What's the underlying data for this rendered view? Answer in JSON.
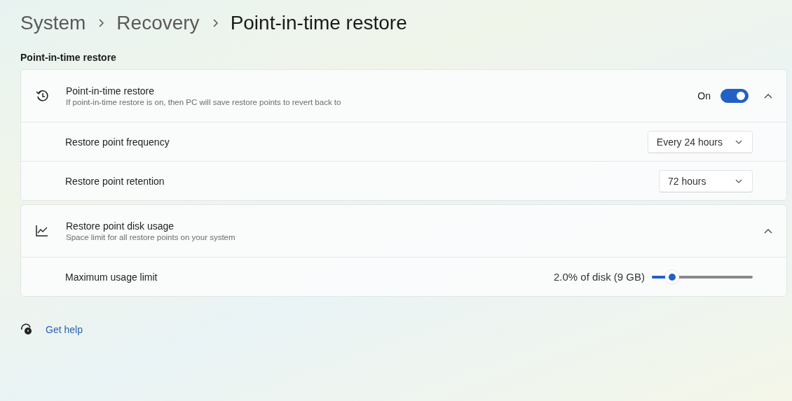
{
  "breadcrumb": [
    {
      "label": "System",
      "current": false
    },
    {
      "label": "Recovery",
      "current": false
    },
    {
      "label": "Point-in-time restore",
      "current": true
    }
  ],
  "section_title": "Point-in-time restore",
  "cards": [
    {
      "title": "Point-in-time restore",
      "subtitle": "If point-in-time restore is on, then PC will save restore points to revert back to",
      "toggle": {
        "label": "On",
        "on": true
      },
      "expanded": true,
      "rows": [
        {
          "kind": "dropdown",
          "label": "Restore point frequency",
          "value": "Every 24 hours"
        },
        {
          "kind": "dropdown",
          "label": "Restore point retention",
          "value": "72 hours"
        }
      ]
    },
    {
      "title": "Restore point disk usage",
      "subtitle": "Space limit for all restore points on your system",
      "expanded": true,
      "rows": [
        {
          "kind": "slider",
          "label": "Maximum usage limit",
          "reading": "2.0% of disk (9 GB)",
          "level": 0.2
        }
      ]
    }
  ],
  "help_link": "Get help"
}
